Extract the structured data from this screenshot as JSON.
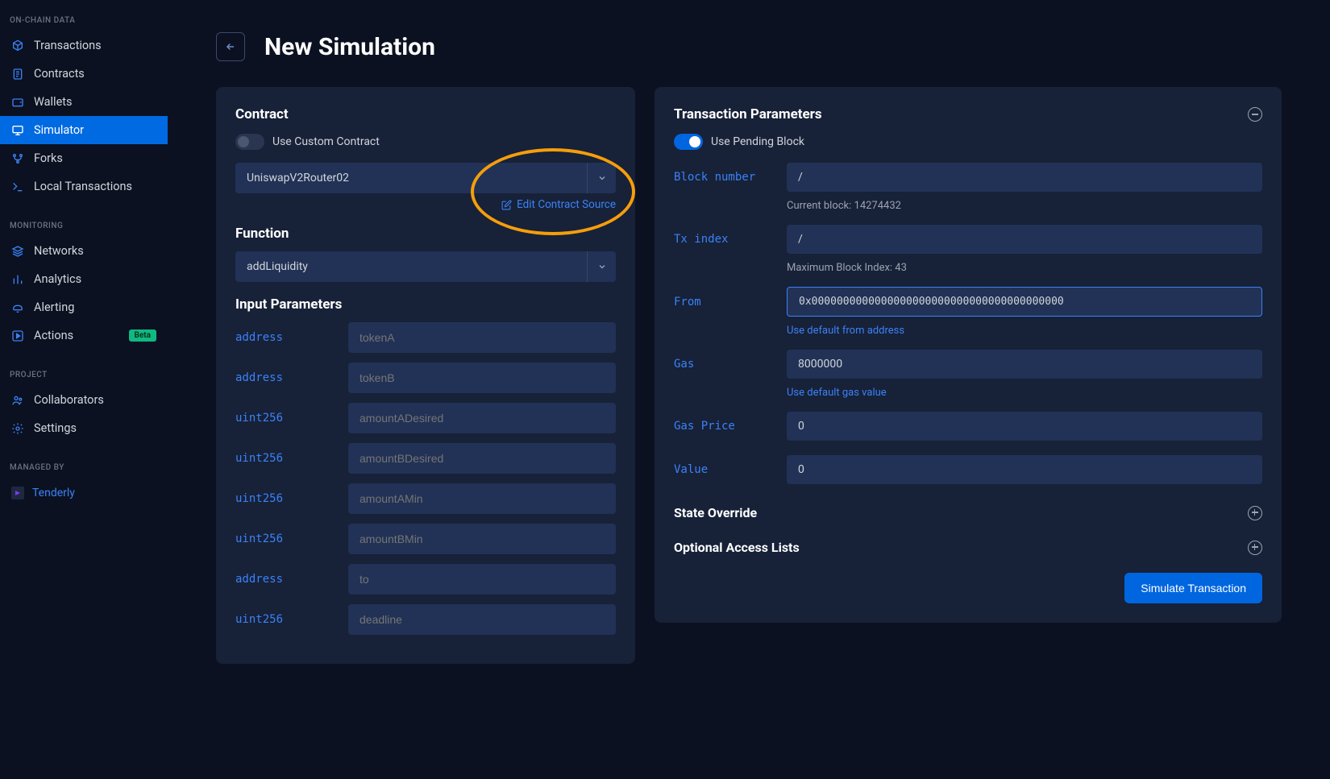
{
  "sidebar": {
    "sections": {
      "onchain": {
        "header": "ON-CHAIN DATA",
        "items": [
          {
            "label": "Transactions",
            "icon": "cube"
          },
          {
            "label": "Contracts",
            "icon": "document"
          },
          {
            "label": "Wallets",
            "icon": "wallet"
          },
          {
            "label": "Simulator",
            "icon": "monitor",
            "active": true
          },
          {
            "label": "Forks",
            "icon": "fork"
          },
          {
            "label": "Local Transactions",
            "icon": "terminal"
          }
        ]
      },
      "monitoring": {
        "header": "MONITORING",
        "items": [
          {
            "label": "Networks",
            "icon": "layers"
          },
          {
            "label": "Analytics",
            "icon": "bars"
          },
          {
            "label": "Alerting",
            "icon": "bell"
          },
          {
            "label": "Actions",
            "icon": "play",
            "badge": "Beta"
          }
        ]
      },
      "project": {
        "header": "PROJECT",
        "items": [
          {
            "label": "Collaborators",
            "icon": "users"
          },
          {
            "label": "Settings",
            "icon": "gear"
          }
        ]
      }
    },
    "managedBy": {
      "header": "MANAGED BY",
      "label": "Tenderly"
    }
  },
  "page": {
    "title": "New Simulation"
  },
  "contractPanel": {
    "title": "Contract",
    "useCustomLabel": "Use Custom Contract",
    "selectedContract": "UniswapV2Router02",
    "editSourceLabel": "Edit Contract Source",
    "functionTitle": "Function",
    "selectedFunction": "addLiquidity",
    "inputParamsTitle": "Input Parameters",
    "inputs": [
      {
        "type": "address",
        "placeholder": "tokenA"
      },
      {
        "type": "address",
        "placeholder": "tokenB"
      },
      {
        "type": "uint256",
        "placeholder": "amountADesired"
      },
      {
        "type": "uint256",
        "placeholder": "amountBDesired"
      },
      {
        "type": "uint256",
        "placeholder": "amountAMin"
      },
      {
        "type": "uint256",
        "placeholder": "amountBMin"
      },
      {
        "type": "address",
        "placeholder": "to"
      },
      {
        "type": "uint256",
        "placeholder": "deadline"
      }
    ]
  },
  "txPanel": {
    "title": "Transaction Parameters",
    "usePendingLabel": "Use Pending Block",
    "blockNumber": {
      "label": "Block number",
      "value": "/",
      "helper": "Current block: 14274432"
    },
    "txIndex": {
      "label": "Tx index",
      "value": "/",
      "helper": "Maximum Block Index: 43"
    },
    "from": {
      "label": "From",
      "value": "0x0000000000000000000000000000000000000000",
      "helper": "Use default from address"
    },
    "gas": {
      "label": "Gas",
      "value": "8000000",
      "helper": "Use default gas value"
    },
    "gasPrice": {
      "label": "Gas Price",
      "value": "0"
    },
    "value": {
      "label": "Value",
      "value": "0"
    },
    "stateOverrideTitle": "State Override",
    "accessListsTitle": "Optional Access Lists",
    "simulateButton": "Simulate Transaction"
  }
}
